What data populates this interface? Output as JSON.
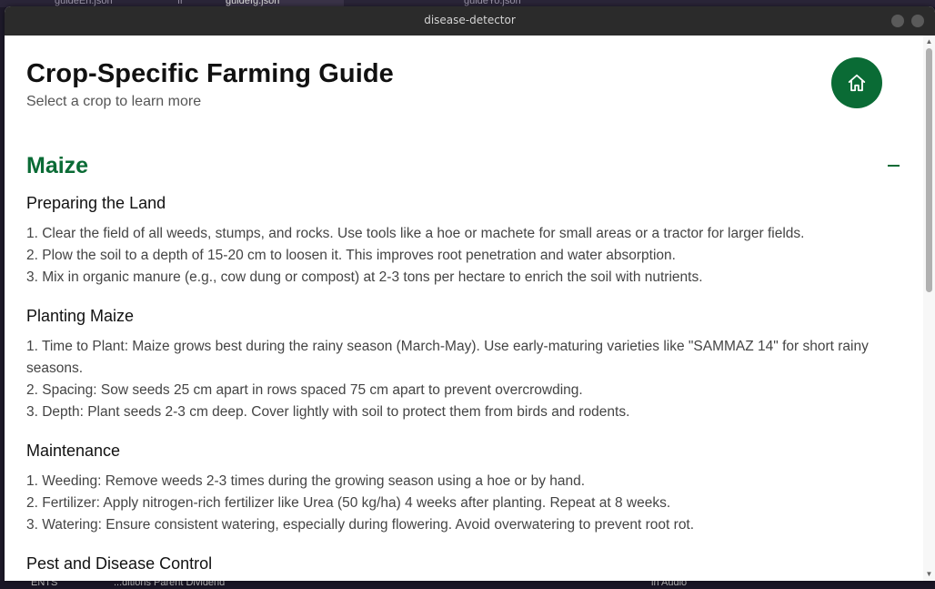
{
  "background": {
    "tabs": [
      "guideEn.json",
      "fr",
      "guideIg.json",
      "guideYo.json"
    ],
    "bottom_text": [
      "ENTS",
      "...ditions Parent Dividend",
      "in Audio"
    ]
  },
  "window": {
    "title": "disease-detector"
  },
  "header": {
    "title": "Crop-Specific Farming Guide",
    "subtitle": "Select a crop to learn more",
    "home_icon": "home-icon"
  },
  "crop": {
    "name": "Maize",
    "collapse_icon": "minus-icon"
  },
  "sections": [
    {
      "title": "Preparing the Land",
      "steps": [
        "1. Clear the field of all weeds, stumps, and rocks. Use tools like a hoe or machete for small areas or a tractor for larger fields.",
        "2. Plow the soil to a depth of 15-20 cm to loosen it. This improves root penetration and water absorption.",
        "3. Mix in organic manure (e.g., cow dung or compost) at 2-3 tons per hectare to enrich the soil with nutrients."
      ]
    },
    {
      "title": "Planting Maize",
      "steps": [
        "1. Time to Plant: Maize grows best during the rainy season (March-May). Use early-maturing varieties like \"SAMMAZ 14\" for short rainy seasons.",
        "2. Spacing: Sow seeds 25 cm apart in rows spaced 75 cm apart to prevent overcrowding.",
        "3. Depth: Plant seeds 2-3 cm deep. Cover lightly with soil to protect them from birds and rodents."
      ]
    },
    {
      "title": "Maintenance",
      "steps": [
        "1. Weeding: Remove weeds 2-3 times during the growing season using a hoe or by hand.",
        "2. Fertilizer: Apply nitrogen-rich fertilizer like Urea (50 kg/ha) 4 weeks after planting. Repeat at 8 weeks.",
        "3. Watering: Ensure consistent watering, especially during flowering. Avoid overwatering to prevent root rot."
      ]
    },
    {
      "title": "Pest and Disease Control",
      "steps": []
    }
  ],
  "colors": {
    "accent": "#0a6b35",
    "titlebar": "#2b2b2b"
  }
}
